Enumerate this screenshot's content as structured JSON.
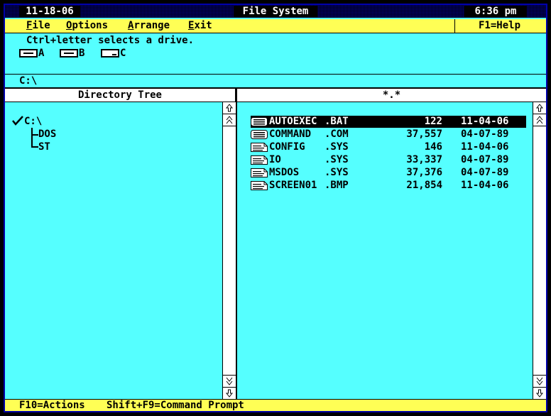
{
  "titlebar": {
    "date": "11-18-06",
    "app_title": "File System",
    "time": "6:36 pm"
  },
  "menu": {
    "file": {
      "mnemonic": "F",
      "rest": "ile"
    },
    "options": {
      "mnemonic": "O",
      "rest": "ptions"
    },
    "arrange": {
      "mnemonic": "A",
      "rest": "rrange"
    },
    "exit": {
      "mnemonic": "E",
      "rest": "xit"
    },
    "help": "F1=Help"
  },
  "drives": {
    "hint": "Ctrl+letter selects a drive.",
    "items": [
      {
        "letter": "A",
        "icon": "floppy-drive-icon"
      },
      {
        "letter": "B",
        "icon": "floppy-drive-icon"
      },
      {
        "letter": "C",
        "icon": "hard-drive-icon"
      }
    ]
  },
  "current_path": "C:\\",
  "tree": {
    "header": "Directory Tree",
    "root": "C:\\",
    "children": [
      "DOS",
      "ST"
    ]
  },
  "files": {
    "header": "*.*",
    "rows": [
      {
        "name": "AUTOEXEC",
        "ext": ".BAT",
        "size": "122",
        "date": "11-04-06",
        "icon": "program-file-icon",
        "selected": true
      },
      {
        "name": "COMMAND",
        "ext": ".COM",
        "size": "37,557",
        "date": "04-07-89",
        "icon": "program-file-icon",
        "selected": false
      },
      {
        "name": "CONFIG",
        "ext": ".SYS",
        "size": "146",
        "date": "11-04-06",
        "icon": "document-file-icon",
        "selected": false
      },
      {
        "name": "IO",
        "ext": ".SYS",
        "size": "33,337",
        "date": "04-07-89",
        "icon": "document-file-icon",
        "selected": false
      },
      {
        "name": "MSDOS",
        "ext": ".SYS",
        "size": "37,376",
        "date": "04-07-89",
        "icon": "document-file-icon",
        "selected": false
      },
      {
        "name": "SCREEN01",
        "ext": ".BMP",
        "size": "21,854",
        "date": "11-04-06",
        "icon": "document-file-icon",
        "selected": false
      }
    ]
  },
  "status": {
    "actions": "F10=Actions",
    "command_prompt": "Shift+F9=Command Prompt"
  }
}
